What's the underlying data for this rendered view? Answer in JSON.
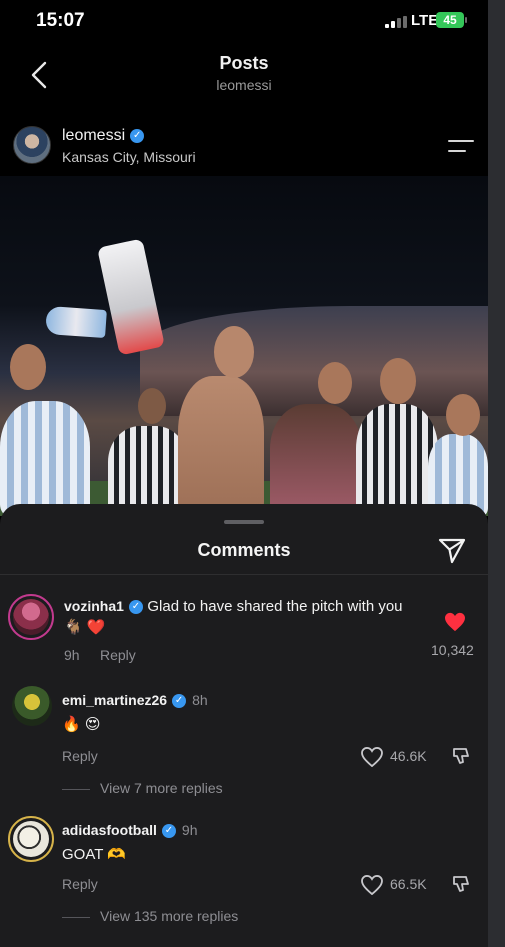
{
  "status_bar": {
    "time": "15:07",
    "network": "LTE",
    "battery": "45"
  },
  "header": {
    "title": "Posts",
    "subtitle": "leomessi"
  },
  "post": {
    "username": "leomessi",
    "location": "Kansas City, Missouri"
  },
  "comments_sheet": {
    "title": "Comments",
    "comments": [
      {
        "username": "vozinha1",
        "text": "Glad to have shared the pitch with you 🐐 ❤️",
        "time": "9h",
        "reply_label": "Reply",
        "like_count": "10,342",
        "liked": true
      },
      {
        "username": "emi_martinez26",
        "time": "8h",
        "text": "🔥 😍",
        "reply_label": "Reply",
        "like_count": "46.6K",
        "view_replies": "View 7 more replies"
      },
      {
        "username": "adidasfootball",
        "time": "9h",
        "text": "GOAT 🫶",
        "reply_label": "Reply",
        "like_count": "66.5K",
        "view_replies": "View 135 more replies"
      }
    ]
  },
  "colors": {
    "verified": "#3897f0",
    "liked_heart": "#ff3040",
    "sheet_bg": "#1c1c1e",
    "battery": "#34c759"
  },
  "icons": [
    "back-chevron-icon",
    "verified-badge-icon",
    "menu-icon",
    "share-send-icon",
    "heart-icon",
    "dislike-icon"
  ]
}
